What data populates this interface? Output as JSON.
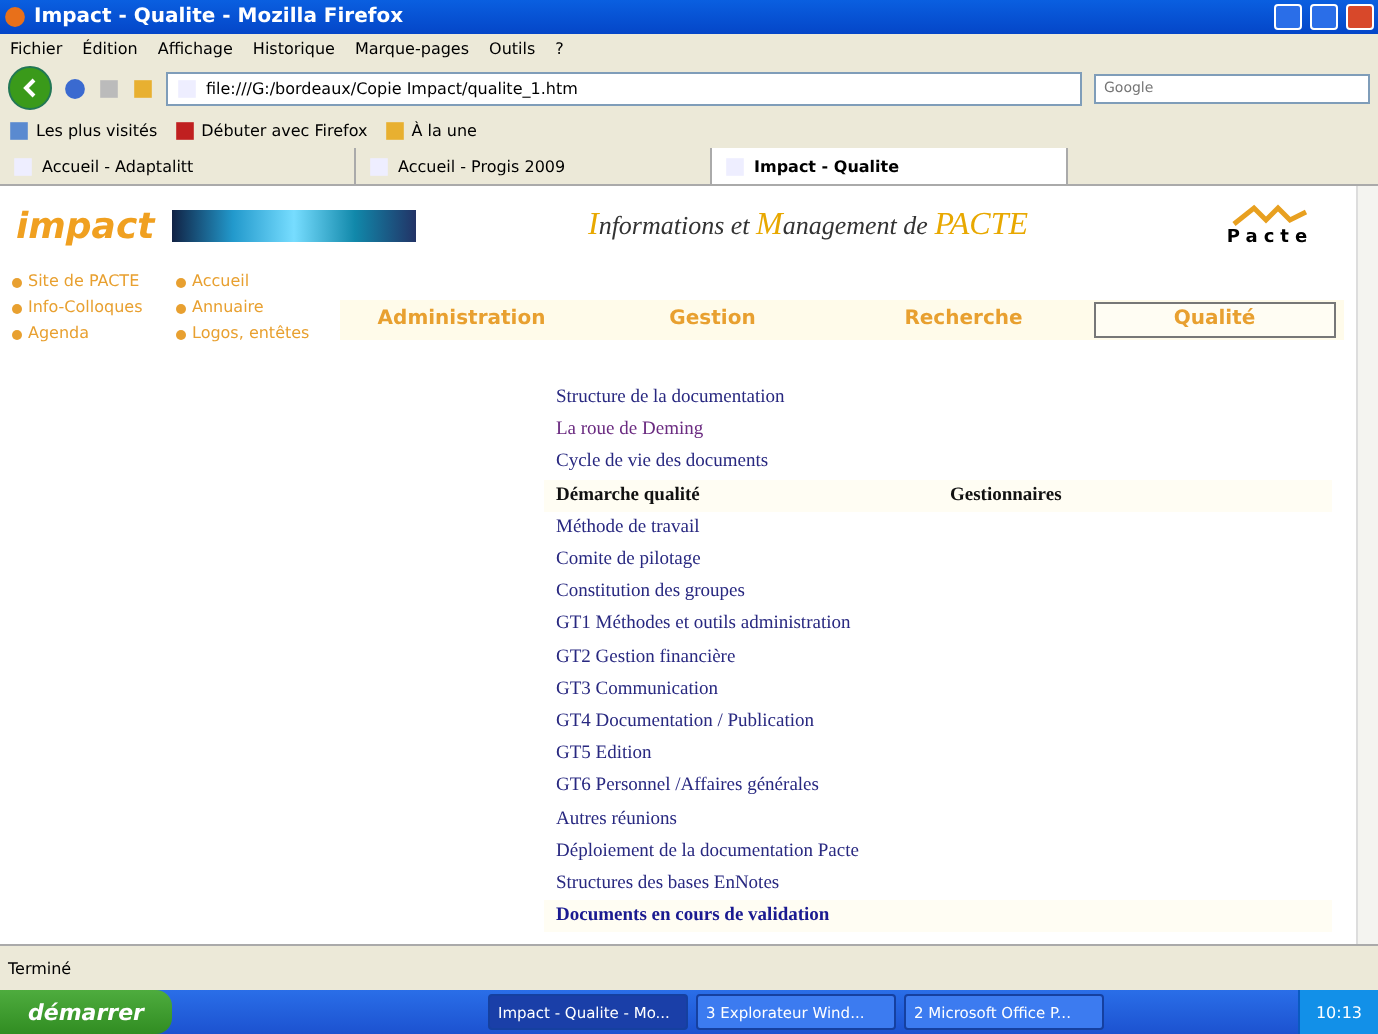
{
  "window": {
    "title": "Impact - Qualite - Mozilla Firefox"
  },
  "menu": [
    "Fichier",
    "Édition",
    "Affichage",
    "Historique",
    "Marque-pages",
    "Outils",
    "?"
  ],
  "address": {
    "value": "file:///G:/bordeaux/Copie Impact/qualite_1.htm"
  },
  "search": {
    "placeholder": "Google"
  },
  "bookmarks": [
    "Les plus visités",
    "Débuter avec Firefox",
    "À la une"
  ],
  "tabs": [
    {
      "label": "Accueil - Adaptalitt",
      "selected": false
    },
    {
      "label": "Accueil - Progis 2009",
      "selected": false
    },
    {
      "label": "Impact - Qualite",
      "selected": true
    }
  ],
  "page": {
    "logo": "impact",
    "headline": "**I**nformations et **M**anagement de **PACTE**",
    "brand": "Pacte",
    "links": [
      [
        "Site de PACTE",
        "Info-Colloques",
        "Agenda"
      ],
      [
        "Accueil",
        "Annuaire",
        "Logos, entêtes"
      ]
    ],
    "nav": [
      {
        "label": "Administration",
        "selected": false
      },
      {
        "label": "Gestion",
        "selected": false
      },
      {
        "label": "Recherche",
        "selected": false
      },
      {
        "label": "Qualité",
        "selected": true
      }
    ],
    "items": [
      {
        "kind": "link",
        "text": "Structure de la documentation",
        "visited": false
      },
      {
        "kind": "link",
        "text": "La roue de Deming",
        "visited": true
      },
      {
        "kind": "link",
        "text": "Cycle de vie des documents",
        "visited": false
      },
      {
        "kind": "heading",
        "text": "Démarche qualité",
        "column_2": "Gestionnaires"
      },
      {
        "kind": "link",
        "text": "Méthode de travail",
        "visited": false
      },
      {
        "kind": "link",
        "text": "Comite de pilotage",
        "visited": false
      },
      {
        "kind": "link",
        "text": "Constitution des groupes",
        "visited": false
      },
      {
        "kind": "link",
        "text": "GT1 Méthodes et outils administration",
        "visited": false
      },
      {
        "kind": "link",
        "text": "GT2 Gestion financière",
        "visited": false
      },
      {
        "kind": "link",
        "text": "GT3 Communication",
        "visited": false
      },
      {
        "kind": "link",
        "text": "GT4 Documentation / Publication",
        "visited": false
      },
      {
        "kind": "link",
        "text": "GT5 Edition",
        "visited": false
      },
      {
        "kind": "link",
        "text": "GT6 Personnel /Affaires générales",
        "visited": false
      },
      {
        "kind": "link",
        "text": "Autres réunions",
        "visited": false
      },
      {
        "kind": "link",
        "text": "Déploiement de la documentation Pacte",
        "visited": false
      },
      {
        "kind": "link",
        "text": "Structures des bases EnNotes",
        "visited": false
      },
      {
        "kind": "section",
        "text": "Documents en cours de validation"
      }
    ]
  },
  "status_bar": "Terminé",
  "taskbar": {
    "start": "démarrer",
    "buttons": [
      {
        "label": "Impact - Qualite - Mo...",
        "selected": true
      },
      {
        "label": "3 Explorateur Wind...",
        "selected": false
      },
      {
        "label": "2 Microsoft Office P...",
        "selected": false
      }
    ],
    "clock": "10:13"
  }
}
